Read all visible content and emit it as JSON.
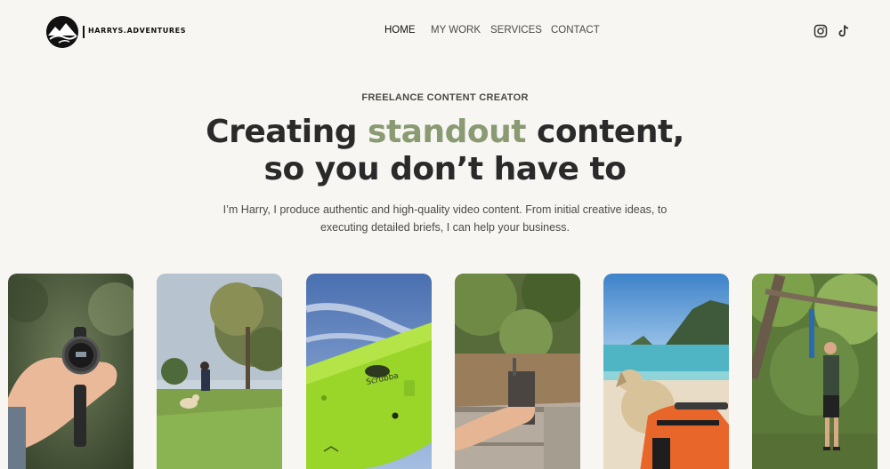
{
  "brand": {
    "name": "HARRYS.ADVENTURES"
  },
  "nav": {
    "items": [
      {
        "label": "HOME",
        "active": true
      },
      {
        "label": "MY WORK",
        "active": false
      },
      {
        "label": "SERVICES",
        "active": false
      },
      {
        "label": "CONTACT",
        "active": false
      }
    ]
  },
  "social": {
    "icons": [
      "instagram-icon",
      "tiktok-icon"
    ]
  },
  "hero": {
    "eyebrow": "FREELANCE CONTENT CREATOR",
    "headline_pre": "Creating ",
    "headline_accent": "standout",
    "headline_post": " content,",
    "headline_line2": "so you don’t have to",
    "subtext_line1": "I’m Harry, I produce authentic and high-quality video content. From initial creative ideas, to",
    "subtext_line2": "executing detailed briefs, I can help your business."
  },
  "colors": {
    "background": "#f7f6f2",
    "accent": "#8a9a72",
    "text": "#2a2a2a"
  },
  "gallery": {
    "items": [
      {
        "subject": "hand holding smartwatch"
      },
      {
        "subject": "dog running in field"
      },
      {
        "subject": "green Scrubba bag against sky"
      },
      {
        "subject": "hand on wooden table"
      },
      {
        "subject": "dog at beach in orange harness"
      },
      {
        "subject": "hiker in forest"
      }
    ],
    "scrubba_label": "Scrubba"
  }
}
